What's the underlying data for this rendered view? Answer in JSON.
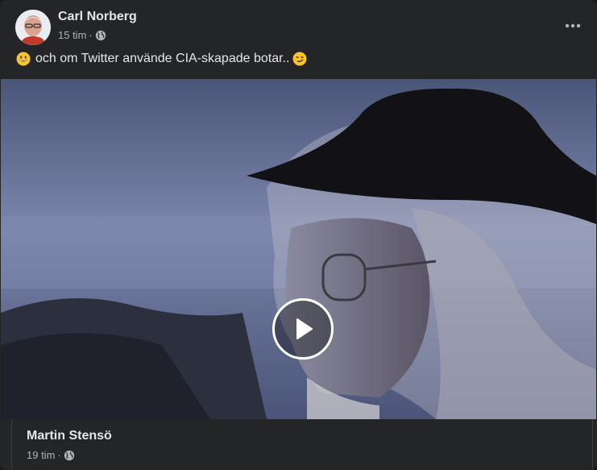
{
  "post": {
    "author": "Carl Norberg",
    "time": "15 tim",
    "separator": "·",
    "privacy_icon": "globe-icon",
    "more_icon": "more-horizontal-icon",
    "text": "och om Twitter använde CIA-skapade botar..",
    "emoji_start": "grinning-face-emoji",
    "emoji_end": "smirking-face-emoji"
  },
  "video": {
    "play_icon": "play-icon"
  },
  "shared_post": {
    "author": "Martin Stensö",
    "time": "19 tim",
    "separator": "·",
    "privacy_icon": "globe-icon"
  },
  "colors": {
    "card_bg": "#242526",
    "primary_text": "#e4e6eb",
    "secondary_text": "#b0b3b8",
    "emoji_yellow": "#f7c32e"
  }
}
